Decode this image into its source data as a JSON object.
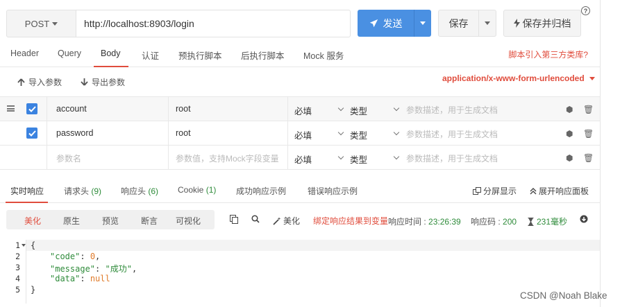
{
  "request": {
    "method": "POST",
    "url": "http://localhost:8903/login",
    "send_label": "发送",
    "save_label": "保存",
    "save_archive_label": "保存并归档",
    "help_label": "?"
  },
  "tabs": {
    "items": [
      "Header",
      "Query",
      "Body",
      "认证",
      "预执行脚本",
      "后执行脚本",
      "Mock 服务"
    ],
    "active": "Body",
    "right_link": "脚本引入第三方类库?"
  },
  "body_toolbar": {
    "import_label": "导入参数",
    "export_label": "导出参数",
    "content_type": "application/x-www-form-urlencoded"
  },
  "params": {
    "rows": [
      {
        "name": "account",
        "value": "root",
        "required": "必填",
        "type": "类型",
        "desc_placeholder": "参数描述，用于生成文档",
        "checked": true
      },
      {
        "name": "password",
        "value": "root",
        "required": "必填",
        "type": "类型",
        "desc_placeholder": "参数描述，用于生成文档",
        "checked": true
      }
    ],
    "new_row": {
      "name_placeholder": "参数名",
      "value_placeholder": "参数值，支持Mock字段变量",
      "required": "必填",
      "type": "类型",
      "desc_placeholder": "参数描述，用于生成文档"
    }
  },
  "response_tabs": {
    "realtime": "实时响应",
    "req_headers": "请求头",
    "req_headers_count": "(9)",
    "resp_headers": "响应头",
    "resp_headers_count": "(6)",
    "cookie": "Cookie",
    "cookie_count": "(1)",
    "success_example": "成功响应示例",
    "error_example": "错误响应示例",
    "split_view": "分屏显示",
    "expand_panel": "展开响应面板"
  },
  "format_bar": {
    "items": [
      "美化",
      "原生",
      "预览",
      "断言",
      "可视化"
    ],
    "active": "美化",
    "beautify": "美化",
    "bind_var": "绑定响应结果到变量",
    "resp_time_label": "响应时间 : ",
    "resp_time": "23:26:39",
    "resp_code_label": "响应码 : ",
    "resp_code": "200",
    "duration": "231毫秒"
  },
  "response_body": {
    "line_numbers": [
      "1",
      "2",
      "3",
      "4",
      "5"
    ],
    "lines": [
      "{",
      "\"code\": 0,",
      "\"message\": \"成功\",",
      "\"data\": null",
      "}"
    ]
  },
  "watermark": "CSDN @Noah Blake",
  "colors": {
    "accent": "#e04c3c",
    "primary": "#4a90e2",
    "checkbox": "#3b83e0",
    "success": "#2e8b3a"
  }
}
